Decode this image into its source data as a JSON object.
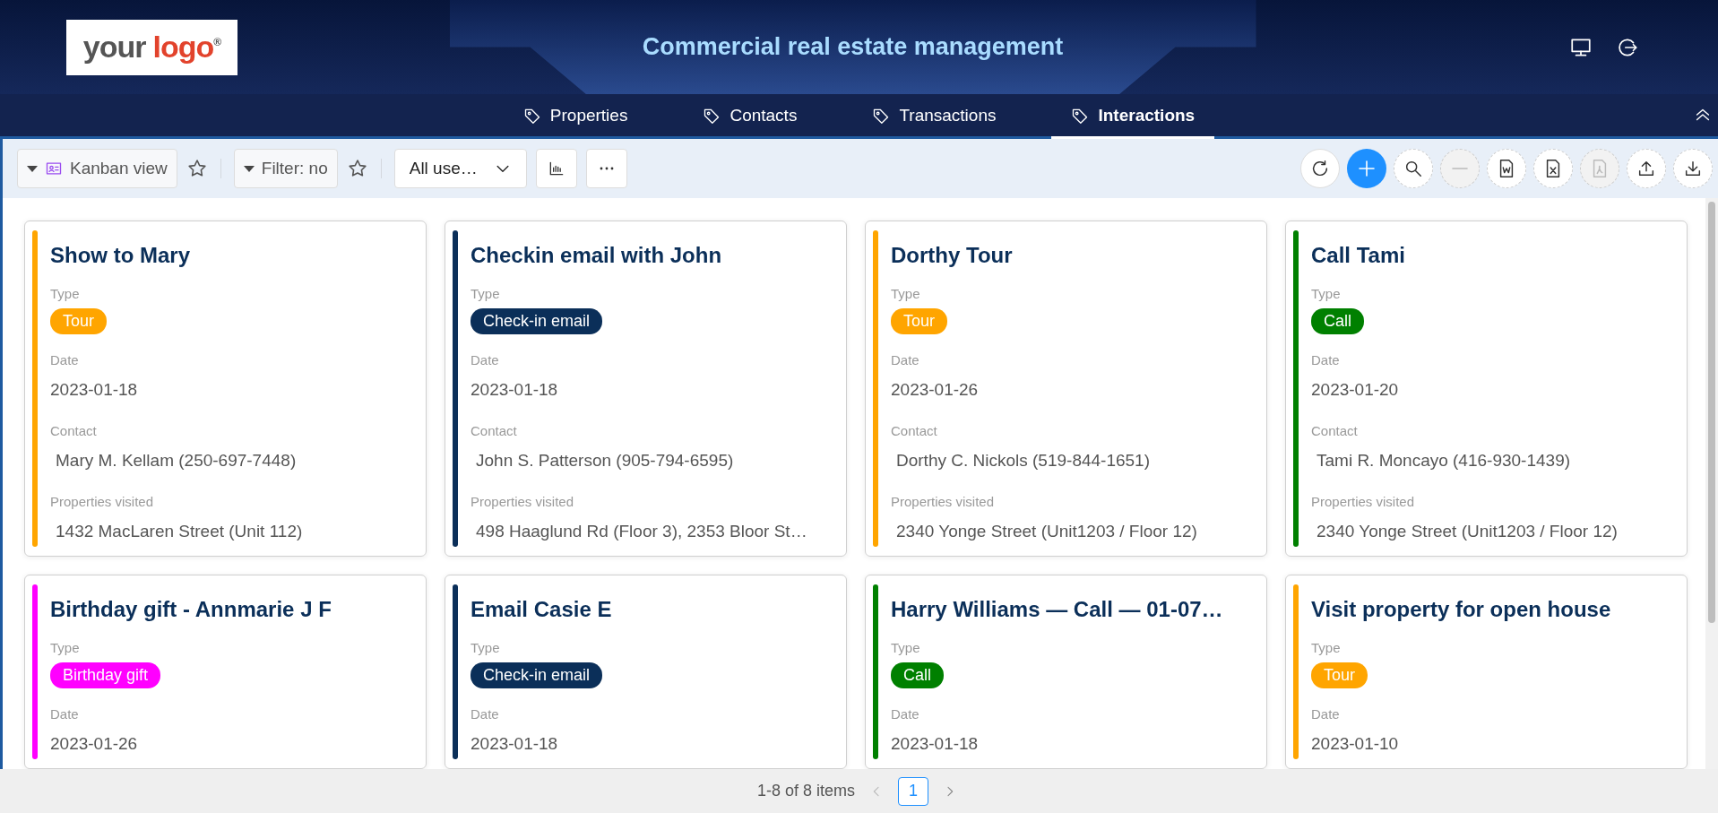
{
  "header": {
    "logo": {
      "word_1": "your",
      "word_2": "logo",
      "mark": "®"
    },
    "title": "Commercial real estate management"
  },
  "tabs": [
    {
      "label": "Properties",
      "selected": false
    },
    {
      "label": "Contacts",
      "selected": false
    },
    {
      "label": "Transactions",
      "selected": false
    },
    {
      "label": "Interactions",
      "selected": true
    }
  ],
  "toolbar": {
    "view": "Kanban view",
    "filter": "Filter: no",
    "users": "All use…",
    "actions": [
      {
        "kind": "refresh",
        "disabled": false
      },
      {
        "kind": "add",
        "disabled": false
      },
      {
        "kind": "search",
        "disabled": false
      },
      {
        "kind": "remove",
        "disabled": true
      },
      {
        "kind": "word",
        "disabled": false
      },
      {
        "kind": "excel",
        "disabled": false
      },
      {
        "kind": "pdf",
        "disabled": true
      },
      {
        "kind": "upload",
        "disabled": false
      },
      {
        "kind": "download",
        "disabled": false
      }
    ]
  },
  "cards": [
    {
      "title": "Show to Mary",
      "color": "#ffa500",
      "fields": [
        {
          "kind": "tag",
          "label": "Type",
          "value": "Tour"
        },
        {
          "kind": "text",
          "label": "Date",
          "value": "2023-01-18"
        },
        {
          "kind": "ref",
          "label": "Contact",
          "value": "Mary M. Kellam (250-697-7448)"
        },
        {
          "kind": "ref",
          "label": "Properties visited",
          "value": "1432 MacLaren Street (Unit 112)"
        }
      ]
    },
    {
      "title": "Checkin email with John",
      "color": "#0b2f59",
      "fields": [
        {
          "kind": "tag",
          "label": "Type",
          "value": "Check-in email"
        },
        {
          "kind": "text",
          "label": "Date",
          "value": "2023-01-18"
        },
        {
          "kind": "ref",
          "label": "Contact",
          "value": "John S. Patterson (905-794-6595)"
        },
        {
          "kind": "ref",
          "label": "Properties visited",
          "value": "498 Haaglund Rd (Floor 3), 2353 Bloor St…"
        }
      ]
    },
    {
      "title": "Dorthy Tour",
      "color": "#ffa500",
      "fields": [
        {
          "kind": "tag",
          "label": "Type",
          "value": "Tour"
        },
        {
          "kind": "text",
          "label": "Date",
          "value": "2023-01-26"
        },
        {
          "kind": "ref",
          "label": "Contact",
          "value": "Dorthy C. Nickols (519-844-1651)"
        },
        {
          "kind": "ref",
          "label": "Properties visited",
          "value": "2340 Yonge Street (Unit1203 / Floor 12)"
        }
      ]
    },
    {
      "title": "Call Tami",
      "color": "#008000",
      "fields": [
        {
          "kind": "tag",
          "label": "Type",
          "value": "Call"
        },
        {
          "kind": "text",
          "label": "Date",
          "value": "2023-01-20"
        },
        {
          "kind": "ref",
          "label": "Contact",
          "value": "Tami R. Moncayo (416-930-1439)"
        },
        {
          "kind": "ref",
          "label": "Properties visited",
          "value": "2340 Yonge Street (Unit1203 / Floor 12)"
        }
      ]
    },
    {
      "title": "Birthday gift - Annmarie J F",
      "color": "#ff00ff",
      "fields": [
        {
          "kind": "tag",
          "label": "Type",
          "value": "Birthday gift"
        },
        {
          "kind": "text",
          "label": "Date",
          "value": "2023-01-26"
        }
      ]
    },
    {
      "title": "Email Casie E",
      "color": "#0b2f59",
      "fields": [
        {
          "kind": "tag",
          "label": "Type",
          "value": "Check-in email"
        },
        {
          "kind": "text",
          "label": "Date",
          "value": "2023-01-18"
        }
      ]
    },
    {
      "title": "Harry Williams — Call — 01-07…",
      "color": "#008000",
      "fields": [
        {
          "kind": "tag",
          "label": "Type",
          "value": "Call"
        },
        {
          "kind": "text",
          "label": "Date",
          "value": "2023-01-18"
        }
      ]
    },
    {
      "title": "Visit property for open house",
      "color": "#ffa500",
      "fields": [
        {
          "kind": "tag",
          "label": "Type",
          "value": "Tour"
        },
        {
          "kind": "text",
          "label": "Date",
          "value": "2023-01-10"
        }
      ]
    }
  ],
  "pagination": {
    "summary": "1-8 of 8 items",
    "pages": [
      {
        "label": "1",
        "selected": true
      }
    ]
  }
}
